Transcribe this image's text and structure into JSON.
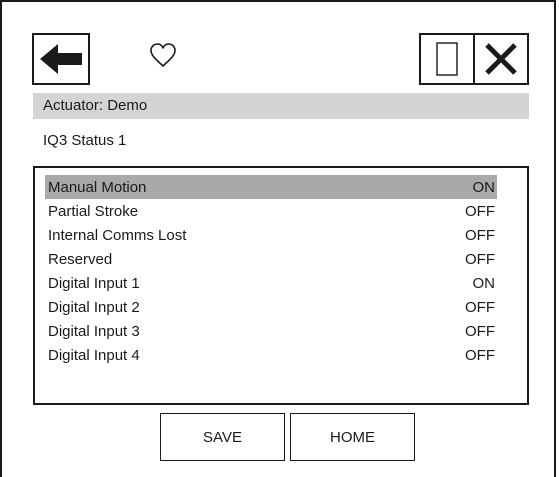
{
  "toolbar": {
    "back_icon": "back-arrow-icon",
    "favorite_icon": "heart-outline-icon",
    "square_icon": "blank-square-icon",
    "close_icon": "close-x-icon"
  },
  "header": {
    "actuator_label": "Actuator: Demo",
    "page_title": "IQ3 Status 1"
  },
  "status": {
    "selected_index": 0,
    "items": [
      {
        "label": "Manual Motion",
        "value": "ON"
      },
      {
        "label": "Partial Stroke",
        "value": "OFF"
      },
      {
        "label": "Internal Comms Lost",
        "value": "OFF"
      },
      {
        "label": "Reserved",
        "value": "OFF"
      },
      {
        "label": "Digital Input 1",
        "value": "ON"
      },
      {
        "label": "Digital Input 2",
        "value": "OFF"
      },
      {
        "label": "Digital Input 3",
        "value": "OFF"
      },
      {
        "label": "Digital Input 4",
        "value": "OFF"
      }
    ]
  },
  "footer": {
    "save_label": "SAVE",
    "home_label": "HOME"
  },
  "colors": {
    "header_bar": "#d4d4d4",
    "selected_row": "#a9a9a9",
    "ink": "#1a1a1a"
  }
}
